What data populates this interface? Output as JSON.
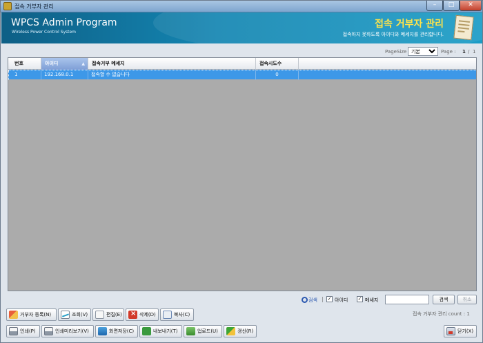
{
  "window": {
    "title": "접속 거부자 관리",
    "icons": [
      "app-icon",
      "minimize-icon",
      "maximize-icon",
      "close-icon"
    ]
  },
  "header": {
    "brand": "WPCS Admin Program",
    "brand_sub": "Wireless Power Control System",
    "page_title": "접속 거부자 관리",
    "page_desc": "접속하지 못하도록 아이디와 메세지를 관리합니다."
  },
  "pager": {
    "pagesize_label": "PageSize",
    "pagesize_value": "기본",
    "page_label": "Page :",
    "current_page": "1",
    "separator": "/",
    "total_pages": "1"
  },
  "grid": {
    "columns": [
      "번호",
      "아이디",
      "접속거부 메세지",
      "접속시도수"
    ],
    "sort_indicator": "▲",
    "rows": [
      {
        "no": "1",
        "id": "192.168.0.1",
        "message": "접속할 수 없습니다",
        "attempts": "0",
        "selected": true
      }
    ],
    "selected_row_color": "#3d98e8"
  },
  "search": {
    "label": "검색",
    "separator": "|",
    "check_id_label": "아이디",
    "check_id_checked": true,
    "check_msg_label": "메세지",
    "check_msg_checked": true,
    "input_value": "",
    "search_button": "검색",
    "cancel_button": "취소"
  },
  "status": {
    "count_text": "접속 거부자 관리 count : 1"
  },
  "toolbar1": [
    {
      "name": "add-denied-user-button",
      "label": "거부자 등록(N)",
      "icon": "add-user-icon"
    },
    {
      "name": "view-button",
      "label": "조회(V)",
      "icon": "view-icon"
    },
    {
      "name": "edit-button",
      "label": "편집(E)",
      "icon": "edit-icon"
    },
    {
      "name": "delete-button",
      "label": "삭제(D)",
      "icon": "delete-icon"
    },
    {
      "name": "copy-button",
      "label": "복사(C)",
      "icon": "copy-icon"
    }
  ],
  "toolbar2": [
    {
      "name": "print-button",
      "label": "인쇄(P)",
      "icon": "printer-icon"
    },
    {
      "name": "print-preview-button",
      "label": "인쇄미리보기(V)",
      "icon": "print-preview-icon"
    },
    {
      "name": "save-screen-button",
      "label": "화면저장(C)",
      "icon": "screen-save-icon"
    },
    {
      "name": "export-button",
      "label": "내보내기(T)",
      "icon": "export-icon"
    },
    {
      "name": "upload-button",
      "label": "업로드(U)",
      "icon": "upload-icon"
    },
    {
      "name": "refresh-button",
      "label": "갱신(R)",
      "icon": "refresh-icon"
    }
  ],
  "close_button": {
    "label": "닫기(X)",
    "icon": "exit-icon"
  }
}
